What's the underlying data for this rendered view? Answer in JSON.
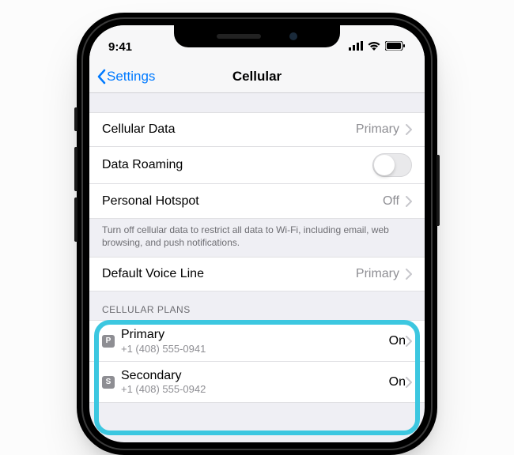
{
  "status": {
    "time": "9:41"
  },
  "nav": {
    "back": "Settings",
    "title": "Cellular"
  },
  "rows": {
    "cellular_data": {
      "label": "Cellular Data",
      "value": "Primary"
    },
    "data_roaming": {
      "label": "Data Roaming"
    },
    "hotspot": {
      "label": "Personal Hotspot",
      "value": "Off"
    },
    "note": "Turn off cellular data to restrict all data to Wi-Fi, including email, web browsing, and push notifications.",
    "default_voice": {
      "label": "Default Voice Line",
      "value": "Primary"
    }
  },
  "plans_header": "CELLULAR PLANS",
  "plans": [
    {
      "badge": "P",
      "name": "Primary",
      "number": "+1 (408) 555-0941",
      "status": "On"
    },
    {
      "badge": "S",
      "name": "Secondary",
      "number": "+1 (408) 555-0942",
      "status": "On"
    }
  ]
}
